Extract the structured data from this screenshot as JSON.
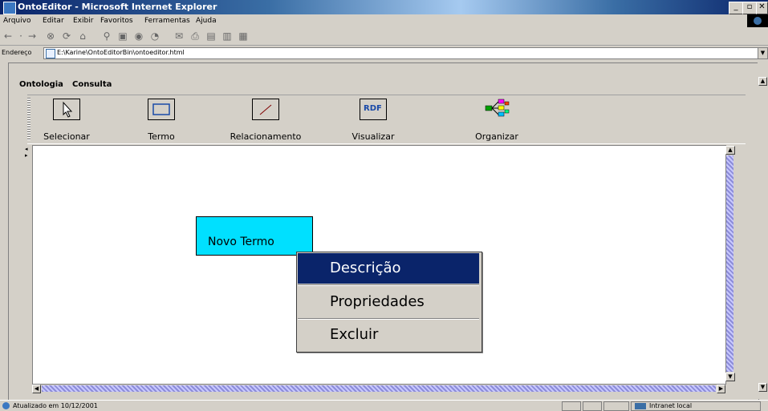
{
  "window": {
    "title": "OntoEditor - Microsoft Internet Explorer",
    "controls": {
      "minimize": "_",
      "maximize": "▫",
      "close": "✕"
    }
  },
  "browser_menu": [
    "Arquivo",
    "Editar",
    "Exibir",
    "Favoritos",
    "Ferramentas",
    "Ajuda"
  ],
  "address": {
    "label": "Endereço",
    "url": "E:\\Karine\\OntoEditorBin\\ontoeditor.html"
  },
  "app": {
    "menus": [
      "Ontologia",
      "Consulta"
    ],
    "tools": [
      {
        "label": "Selecionar",
        "icon": "cursor-icon"
      },
      {
        "label": "Termo",
        "icon": "rectangle-icon"
      },
      {
        "label": "Relacionamento",
        "icon": "line-icon"
      },
      {
        "label": "Visualizar",
        "icon": "rdf-icon",
        "icon_text": "RDF"
      },
      {
        "label": "Organizar",
        "icon": "organize-icon"
      }
    ]
  },
  "canvas": {
    "node": {
      "label": "Novo Termo",
      "color": "#00e0ff"
    }
  },
  "context_menu": {
    "items": [
      {
        "label": "Descrição",
        "selected": true
      },
      {
        "label": "Propriedades",
        "selected": false
      },
      {
        "label": "Excluir",
        "selected": false
      }
    ],
    "highlight_color": "#0a246a"
  },
  "status": {
    "text": "Atualizado em 10/12/2001",
    "zone": "Intranet local"
  }
}
